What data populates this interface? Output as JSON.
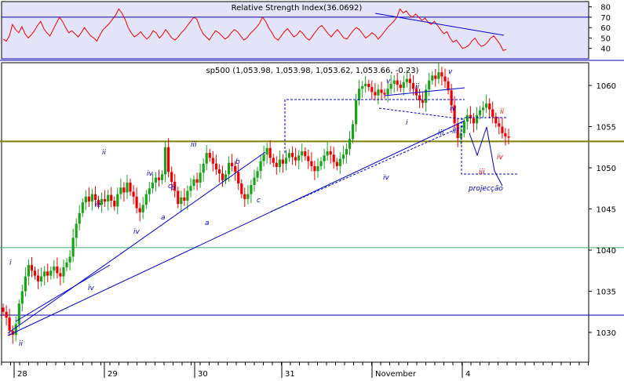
{
  "chart_data": [
    {
      "type": "line",
      "title": "Relative Strength Index(36.0692)",
      "series": [
        {
          "values": [
            49,
            47,
            52,
            63,
            58,
            55,
            61,
            54,
            50,
            53,
            57,
            62,
            66,
            59,
            55,
            52,
            58,
            64,
            70,
            66,
            60,
            55,
            57,
            54,
            51,
            55,
            60,
            56,
            52,
            50,
            47,
            53,
            58,
            61,
            64,
            68,
            72,
            78,
            74,
            68,
            60,
            55,
            51,
            53,
            56,
            52,
            49,
            52,
            57,
            55,
            50,
            53,
            58,
            54,
            50,
            48,
            51,
            55,
            58,
            62,
            66,
            70,
            68,
            60,
            54,
            51,
            48,
            53,
            57,
            55,
            52,
            49,
            51,
            55,
            58,
            56,
            52,
            48,
            50,
            54,
            57,
            60,
            64,
            70,
            66,
            60,
            55,
            50,
            48,
            52,
            56,
            59,
            55,
            51,
            53,
            57,
            54,
            50,
            48,
            52,
            56,
            60,
            62,
            58,
            54,
            51,
            55,
            58,
            54,
            50,
            49,
            53,
            57,
            60,
            58,
            54,
            50,
            52,
            55,
            53,
            49,
            52,
            56,
            60,
            63,
            66,
            70,
            78,
            74,
            76,
            72,
            70,
            73,
            70,
            67,
            69,
            65,
            63,
            66,
            62,
            58,
            54,
            56,
            50,
            46,
            48,
            44,
            40,
            41,
            43,
            47,
            50,
            45,
            42,
            43,
            46,
            50,
            52,
            48,
            44,
            38,
            39
          ]
        }
      ],
      "ylim": [
        30,
        85
      ],
      "yticks": [
        40,
        50,
        60,
        70,
        80
      ],
      "reference_lines": [
        70,
        30
      ],
      "legend": "none",
      "grid": false
    },
    {
      "type": "candlestick",
      "title": "sp500 (1,053.98, 1,053.98, 1,053.62, 1,053.66, -0.23)",
      "categories": [
        "28",
        "29",
        "30",
        "31",
        "November",
        "4"
      ],
      "ylim": [
        1025,
        1068
      ],
      "yticks": [
        1030,
        1035,
        1040,
        1045,
        1050,
        1055,
        1060
      ],
      "horizontal_levels": [
        1053.2,
        1040.3,
        1032.1
      ],
      "series": [
        {
          "values": [
            1032.5,
            1031.8,
            1030.2,
            1029.7,
            1031.0,
            1033.5,
            1035.0,
            1036.8,
            1038.2,
            1037.5,
            1036.9,
            1036.2,
            1036.8,
            1037.4,
            1036.9,
            1037.5,
            1038.0,
            1037.2,
            1036.8,
            1037.9,
            1038.5,
            1039.2,
            1041.5,
            1043.2,
            1044.5,
            1045.8,
            1046.5,
            1045.9,
            1046.8,
            1046.1,
            1045.5,
            1046.2,
            1045.9,
            1046.7,
            1046.0,
            1045.3,
            1046.8,
            1047.6,
            1047.0,
            1048.2,
            1047.1,
            1046.5,
            1045.1,
            1044.6,
            1045.5,
            1046.8,
            1047.5,
            1048.2,
            1048.8,
            1048.5,
            1049.2,
            1052.5,
            1049.5,
            1048.3,
            1047.2,
            1045.6,
            1046.4,
            1046.0,
            1047.2,
            1047.8,
            1048.6,
            1048.2,
            1049.4,
            1050.5,
            1051.8,
            1051.2,
            1050.5,
            1049.8,
            1049.3,
            1048.5,
            1049.2,
            1050.6,
            1050.2,
            1049.5,
            1048.1,
            1046.8,
            1046.2,
            1046.8,
            1047.9,
            1048.8,
            1049.6,
            1050.8,
            1051.6,
            1052.4,
            1051.2,
            1050.6,
            1050.1,
            1051.0,
            1050.5,
            1051.2,
            1051.8,
            1051.3,
            1050.9,
            1051.5,
            1052.0,
            1051.4,
            1050.8,
            1050.2,
            1049.6,
            1050.2,
            1050.8,
            1051.5,
            1052.0,
            1051.6,
            1050.7,
            1050.2,
            1051.1,
            1051.6,
            1052.3,
            1053.5,
            1055.3,
            1058.2,
            1059.6,
            1059.9,
            1060.2,
            1059.8,
            1059.2,
            1058.8,
            1059.5,
            1059.1,
            1058.9,
            1059.6,
            1060.2,
            1060.6,
            1060.1,
            1059.7,
            1060.4,
            1060.8,
            1060.3,
            1059.6,
            1058.8,
            1058.2,
            1057.9,
            1059.5,
            1060.6,
            1061.2,
            1060.8,
            1061.6,
            1061.1,
            1060.5,
            1059.4,
            1057.6,
            1055.4,
            1053.6,
            1054.2,
            1055.6,
            1056.4,
            1056.0,
            1055.4,
            1056.4,
            1057.0,
            1057.3,
            1057.8,
            1057.1,
            1056.2,
            1055.4,
            1055.0,
            1054.2,
            1053.8,
            1053.66
          ]
        }
      ],
      "annotations": [
        "i",
        "ii",
        "iii",
        "iv",
        "ii",
        "a",
        "b",
        "c",
        "iii",
        "iv",
        "b",
        "a",
        "c",
        "iii",
        "iv",
        "v",
        "ii",
        "i",
        "iv",
        "iii",
        "iv",
        "v",
        "ii",
        "iii",
        "iv",
        "projecção"
      ],
      "legend": "none",
      "grid": false
    }
  ]
}
